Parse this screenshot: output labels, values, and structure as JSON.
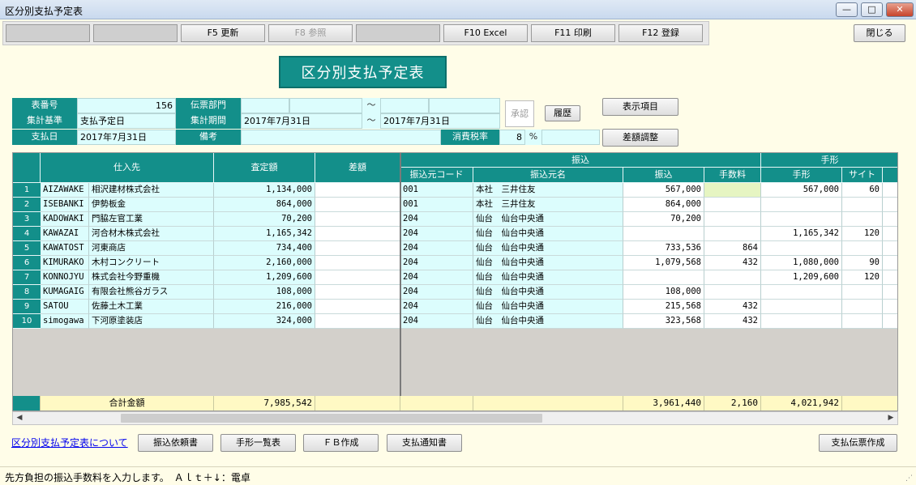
{
  "window": {
    "title": "区分別支払予定表",
    "min": "—",
    "max": "□",
    "close": "✕"
  },
  "fkeys": [
    {
      "label": ""
    },
    {
      "label": ""
    },
    {
      "label": "F5 更新"
    },
    {
      "label": "F8 参照"
    },
    {
      "label": ""
    },
    {
      "label": "F10 Excel"
    },
    {
      "label": "F11 印刷"
    },
    {
      "label": "F12 登録"
    }
  ],
  "close_label": "閉じる",
  "page_title": "区分別支払予定表",
  "header": {
    "table_no_label": "表番号",
    "table_no": "156",
    "dept_label": "伝票部門",
    "dept_tilde": "～",
    "basis_label": "集計基準",
    "basis": "支払予定日",
    "period_label": "集計期間",
    "period_from": "2017年7月31日",
    "period_tilde": "～",
    "period_to": "2017年7月31日",
    "paydate_label": "支払日",
    "paydate": "2017年7月31日",
    "note_label": "備考",
    "tax_label": "消費税率",
    "tax_value": "8",
    "tax_unit": "%"
  },
  "stamp": "承認",
  "history_btn": "履歴",
  "display_btn": "表示項目",
  "diff_btn": "差額調整",
  "columns": {
    "supplier": "仕入先",
    "assessed": "査定額",
    "diff": "差額",
    "transfer_group": "振込",
    "src_code": "振込元コード",
    "src_name": "振込元名",
    "transfer": "振込",
    "fee": "手数料",
    "bill_group": "手形",
    "bill": "手形",
    "site": "サイト"
  },
  "rows": [
    {
      "no": "1",
      "code": "AIZAWAKE",
      "name": "相沢建材株式会社",
      "assessed": "1,134,000",
      "diff": "",
      "src_code": "001",
      "src_name": "本社　三井住友",
      "transfer": "567,000",
      "fee": "",
      "bill": "567,000",
      "site": "60"
    },
    {
      "no": "2",
      "code": "ISEBANKI",
      "name": "伊勢板金",
      "assessed": "864,000",
      "diff": "",
      "src_code": "001",
      "src_name": "本社　三井住友",
      "transfer": "864,000",
      "fee": "",
      "bill": "",
      "site": ""
    },
    {
      "no": "3",
      "code": "KADOWAKI",
      "name": "門脇左官工業",
      "assessed": "70,200",
      "diff": "",
      "src_code": "204",
      "src_name": "仙台　仙台中央通",
      "transfer": "70,200",
      "fee": "",
      "bill": "",
      "site": ""
    },
    {
      "no": "4",
      "code": "KAWAZAI",
      "name": "河合材木株式会社",
      "assessed": "1,165,342",
      "diff": "",
      "src_code": "204",
      "src_name": "仙台　仙台中央通",
      "transfer": "",
      "fee": "",
      "bill": "1,165,342",
      "site": "120"
    },
    {
      "no": "5",
      "code": "KAWATOST",
      "name": "河東商店",
      "assessed": "734,400",
      "diff": "",
      "src_code": "204",
      "src_name": "仙台　仙台中央通",
      "transfer": "733,536",
      "fee": "864",
      "bill": "",
      "site": ""
    },
    {
      "no": "6",
      "code": "KIMURAKO",
      "name": "木村コンクリート",
      "assessed": "2,160,000",
      "diff": "",
      "src_code": "204",
      "src_name": "仙台　仙台中央通",
      "transfer": "1,079,568",
      "fee": "432",
      "bill": "1,080,000",
      "site": "90"
    },
    {
      "no": "7",
      "code": "KONNOJYU",
      "name": "株式会社今野重機",
      "assessed": "1,209,600",
      "diff": "",
      "src_code": "204",
      "src_name": "仙台　仙台中央通",
      "transfer": "",
      "fee": "",
      "bill": "1,209,600",
      "site": "120"
    },
    {
      "no": "8",
      "code": "KUMAGAIG",
      "name": "有限会社熊谷ガラス",
      "assessed": "108,000",
      "diff": "",
      "src_code": "204",
      "src_name": "仙台　仙台中央通",
      "transfer": "108,000",
      "fee": "",
      "bill": "",
      "site": ""
    },
    {
      "no": "9",
      "code": "SATOU",
      "name": "佐藤土木工業",
      "assessed": "216,000",
      "diff": "",
      "src_code": "204",
      "src_name": "仙台　仙台中央通",
      "transfer": "215,568",
      "fee": "432",
      "bill": "",
      "site": ""
    },
    {
      "no": "10",
      "code": "simogawa",
      "name": "下河原塗装店",
      "assessed": "324,000",
      "diff": "",
      "src_code": "204",
      "src_name": "仙台　仙台中央通",
      "transfer": "323,568",
      "fee": "432",
      "bill": "",
      "site": ""
    }
  ],
  "totals": {
    "label": "合計金額",
    "assessed": "7,985,542",
    "transfer": "3,961,440",
    "fee": "2,160",
    "bill": "4,021,942"
  },
  "bottom": {
    "help_link": "区分別支払予定表について",
    "transfer_request": "振込依頼書",
    "bill_list": "手形一覧表",
    "fb_create": "ＦＢ作成",
    "pay_notice": "支払通知書",
    "pay_slip": "支払伝票作成"
  },
  "status": "先方負担の振込手数料を入力します。　Ａｌｔ＋↓：電卓"
}
